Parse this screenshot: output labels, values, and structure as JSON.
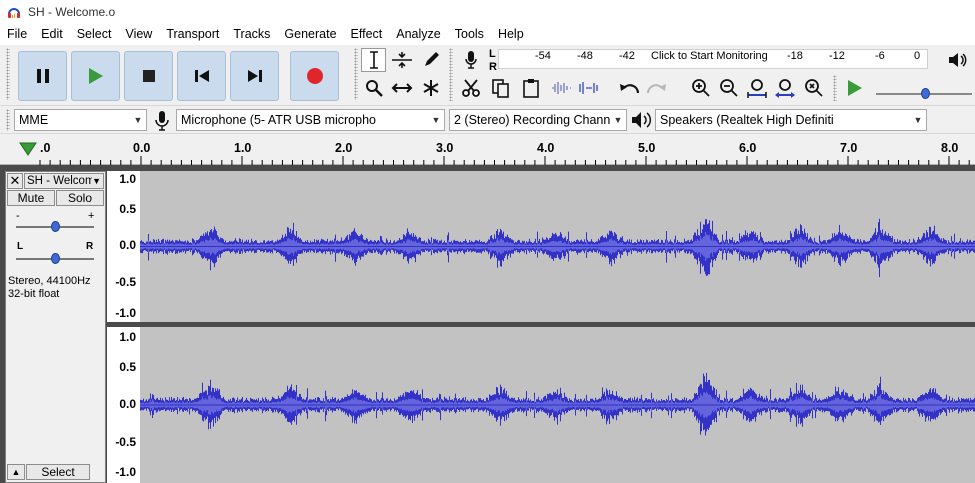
{
  "window": {
    "title": "SH - Welcome.o"
  },
  "menu": [
    "File",
    "Edit",
    "Select",
    "View",
    "Transport",
    "Tracks",
    "Generate",
    "Effect",
    "Analyze",
    "Tools",
    "Help"
  ],
  "meter": {
    "ticks": [
      "-54",
      "-48",
      "-42",
      "-18",
      "-12",
      "-6",
      "0"
    ],
    "click_to_monitor": "Click to Start Monitoring",
    "rec_l": "L",
    "rec_r": "R"
  },
  "devices": {
    "host": "MME",
    "input": "Microphone (5- ATR USB micropho",
    "channels": "2 (Stereo) Recording Chann",
    "output": "Speakers (Realtek High Definiti"
  },
  "ruler": {
    "labels": [
      ".0",
      "0.0",
      "1.0",
      "2.0",
      "3.0",
      "4.0",
      "5.0",
      "6.0",
      "7.0",
      "8.0"
    ]
  },
  "track": {
    "name": "SH - Welcom",
    "mute": "Mute",
    "solo": "Solo",
    "gain_minus": "-",
    "gain_plus": "+",
    "pan_l": "L",
    "pan_r": "R",
    "info_line1": "Stereo, 44100Hz",
    "info_line2": "32-bit float",
    "select": "Select",
    "scale": [
      "1.0",
      "0.5",
      "0.0",
      "-0.5",
      "-1.0"
    ]
  },
  "colors": {
    "waveform": "#3232c8",
    "waveform_rms": "#6464dc",
    "wave_bg": "#c2c2c2",
    "transport_btn": "#c9dbec",
    "record": "#e0262a",
    "play": "#3a9b3a"
  }
}
